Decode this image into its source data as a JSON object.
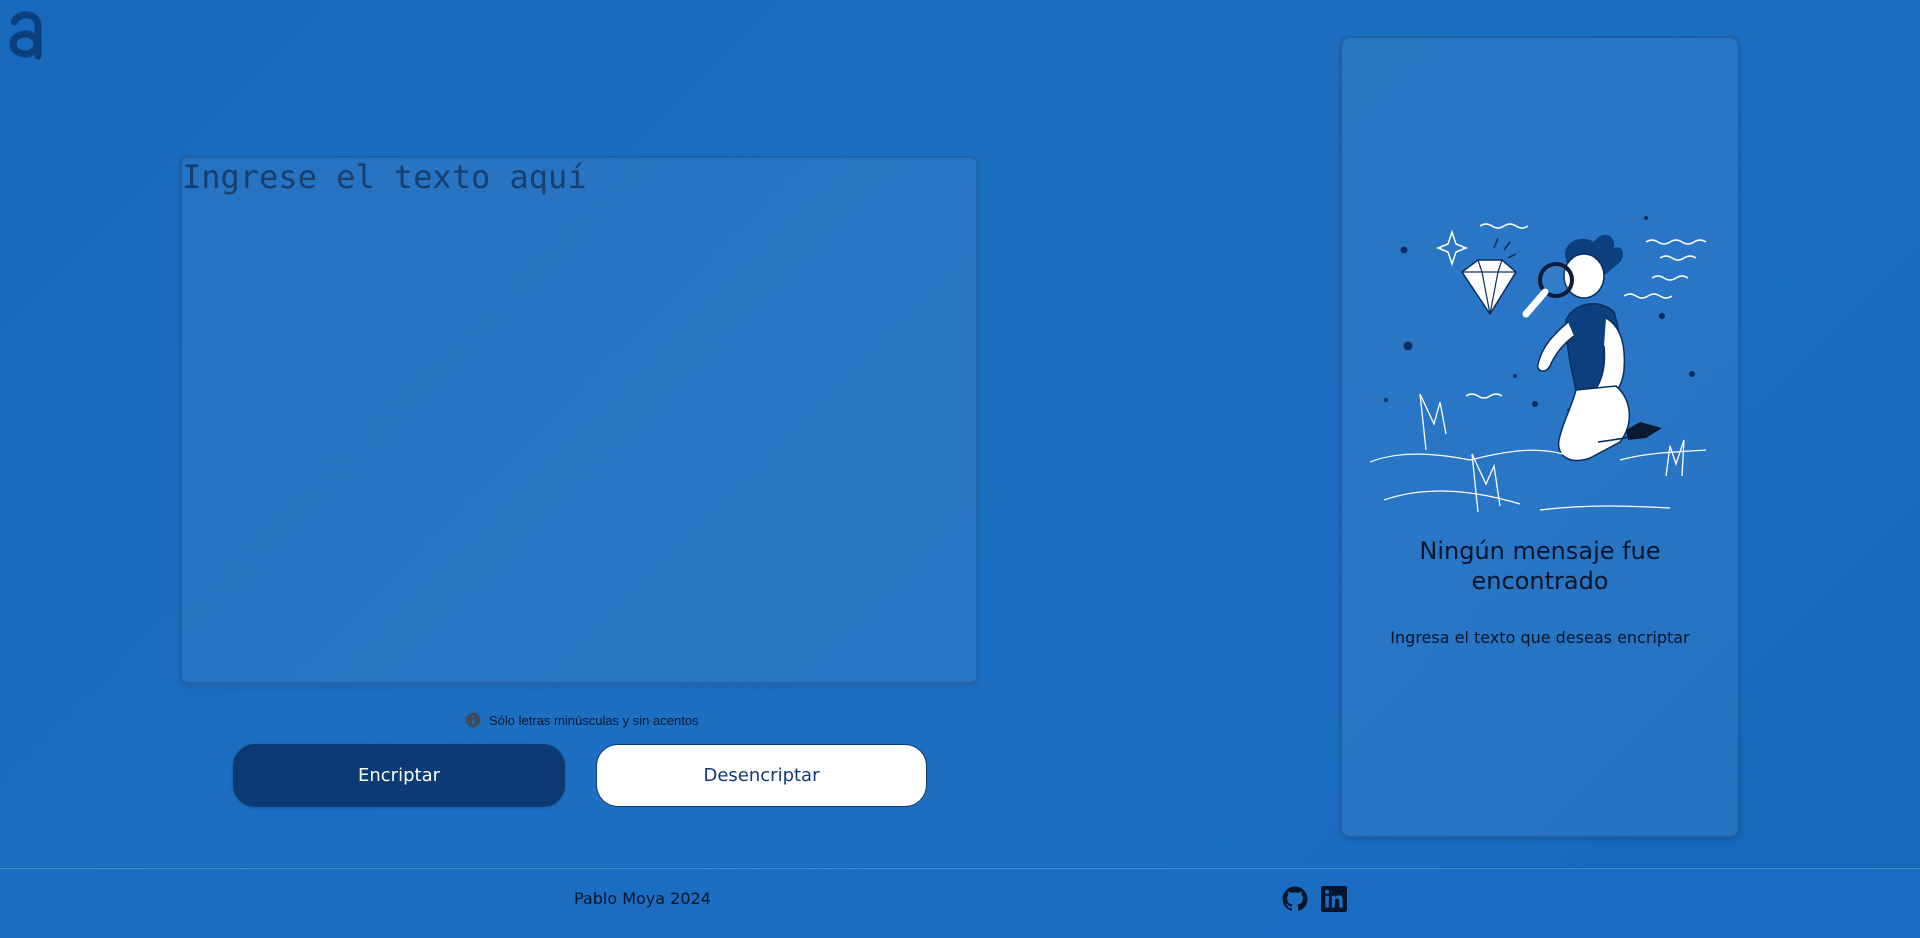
{
  "header": {
    "logo_icon": "alura-logo-icon"
  },
  "input": {
    "placeholder": "Ingrese el texto aquí",
    "value": ""
  },
  "hint": {
    "icon": "info-icon",
    "text": "Sólo letras minúsculas y sin acentos"
  },
  "actions": {
    "encrypt_label": "Encriptar",
    "decrypt_label": "Desencriptar"
  },
  "output": {
    "illustration": "person-with-magnifying-glass-illustration",
    "title": "Ningún mensaje fue encontrado",
    "subtitle": "Ingresa el texto que deseas encriptar"
  },
  "footer": {
    "text": "Pablo Moya 2024",
    "links": [
      {
        "icon": "github-icon"
      },
      {
        "icon": "linkedin-icon"
      }
    ]
  },
  "colors": {
    "background": "#1b6ec2",
    "primary": "#0c3a75",
    "text": "#07152b",
    "button_light": "#ffffff"
  }
}
